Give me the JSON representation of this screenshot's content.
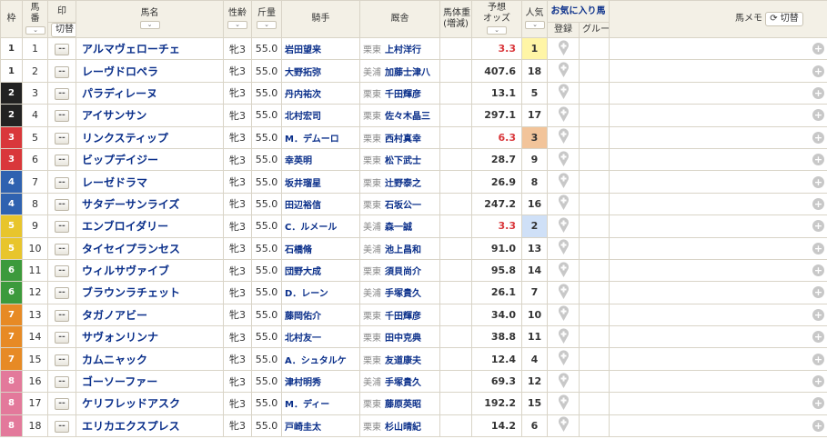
{
  "header": {
    "waku": "枠",
    "umaban_top": "馬",
    "umaban_bottom": "番",
    "mark_top": "印",
    "mark_switch": "切替",
    "horse_name": "馬名",
    "sex_age": "性齢",
    "weight": "斤量",
    "jockey": "騎手",
    "stable": "厩舎",
    "body_weight_top": "馬体重",
    "body_weight_bottom": "(増減)",
    "odds_top": "予想",
    "odds_bottom": "オッズ",
    "popularity": "人気",
    "favorites": "お気に入り馬",
    "fav_register": "登録",
    "fav_group": "グループ",
    "memo": "馬メモ",
    "memo_switch": "切替",
    "sort_icon": "⌄"
  },
  "colors": {
    "header_bg": "#f3f0e6",
    "link_blue": "#0a2f8a",
    "odds_hot": "#d9373b",
    "pop1": "#fff5a6",
    "pop2": "#cfe0f7",
    "pop3": "#f2c49a"
  },
  "rows": [
    {
      "waku": "1",
      "waku_class": "w1",
      "num": "1",
      "mark": "--",
      "name": "アルマヴェローチェ",
      "sexage": "牝3",
      "weight": "55.0",
      "jockey": "岩田望来",
      "place": "栗東",
      "trainer": "上村洋行",
      "odds": "3.3",
      "hot": true,
      "pop": "1",
      "pop_class": "pop1"
    },
    {
      "waku": "1",
      "waku_class": "w1",
      "num": "2",
      "mark": "--",
      "name": "レーヴドロペラ",
      "sexage": "牝3",
      "weight": "55.0",
      "jockey": "大野拓弥",
      "place": "美浦",
      "trainer": "加藤士津八",
      "odds": "407.6",
      "hot": false,
      "pop": "18",
      "pop_class": ""
    },
    {
      "waku": "2",
      "waku_class": "w2",
      "num": "3",
      "mark": "--",
      "name": "パラディレーヌ",
      "sexage": "牝3",
      "weight": "55.0",
      "jockey": "丹内祐次",
      "place": "栗東",
      "trainer": "千田輝彦",
      "odds": "13.1",
      "hot": false,
      "pop": "5",
      "pop_class": ""
    },
    {
      "waku": "2",
      "waku_class": "w2",
      "num": "4",
      "mark": "--",
      "name": "アイサンサン",
      "sexage": "牝3",
      "weight": "55.0",
      "jockey": "北村宏司",
      "place": "栗東",
      "trainer": "佐々木晶三",
      "odds": "297.1",
      "hot": false,
      "pop": "17",
      "pop_class": ""
    },
    {
      "waku": "3",
      "waku_class": "w3",
      "num": "5",
      "mark": "--",
      "name": "リンクスティップ",
      "sexage": "牝3",
      "weight": "55.0",
      "jockey": "M．デムーロ",
      "place": "栗東",
      "trainer": "西村真幸",
      "odds": "6.3",
      "hot": true,
      "pop": "3",
      "pop_class": "pop3"
    },
    {
      "waku": "3",
      "waku_class": "w3",
      "num": "6",
      "mark": "--",
      "name": "ビップデイジー",
      "sexage": "牝3",
      "weight": "55.0",
      "jockey": "幸英明",
      "place": "栗東",
      "trainer": "松下武士",
      "odds": "28.7",
      "hot": false,
      "pop": "9",
      "pop_class": ""
    },
    {
      "waku": "4",
      "waku_class": "w4",
      "num": "7",
      "mark": "--",
      "name": "レーゼドラマ",
      "sexage": "牝3",
      "weight": "55.0",
      "jockey": "坂井瑠星",
      "place": "栗東",
      "trainer": "辻野泰之",
      "odds": "26.9",
      "hot": false,
      "pop": "8",
      "pop_class": ""
    },
    {
      "waku": "4",
      "waku_class": "w4",
      "num": "8",
      "mark": "--",
      "name": "サタデーサンライズ",
      "sexage": "牝3",
      "weight": "55.0",
      "jockey": "田辺裕信",
      "place": "栗東",
      "trainer": "石坂公一",
      "odds": "247.2",
      "hot": false,
      "pop": "16",
      "pop_class": ""
    },
    {
      "waku": "5",
      "waku_class": "w5",
      "num": "9",
      "mark": "--",
      "name": "エンブロイダリー",
      "sexage": "牝3",
      "weight": "55.0",
      "jockey": "C．ルメール",
      "place": "美浦",
      "trainer": "森一誠",
      "odds": "3.3",
      "hot": true,
      "pop": "2",
      "pop_class": "pop2"
    },
    {
      "waku": "5",
      "waku_class": "w5",
      "num": "10",
      "mark": "--",
      "name": "タイセイプランセス",
      "sexage": "牝3",
      "weight": "55.0",
      "jockey": "石橋脩",
      "place": "美浦",
      "trainer": "池上昌和",
      "odds": "91.0",
      "hot": false,
      "pop": "13",
      "pop_class": ""
    },
    {
      "waku": "6",
      "waku_class": "w6",
      "num": "11",
      "mark": "--",
      "name": "ウィルサヴァイブ",
      "sexage": "牝3",
      "weight": "55.0",
      "jockey": "団野大成",
      "place": "栗東",
      "trainer": "須貝尚介",
      "odds": "95.8",
      "hot": false,
      "pop": "14",
      "pop_class": ""
    },
    {
      "waku": "6",
      "waku_class": "w6",
      "num": "12",
      "mark": "--",
      "name": "ブラウンラチェット",
      "sexage": "牝3",
      "weight": "55.0",
      "jockey": "D．レーン",
      "place": "美浦",
      "trainer": "手塚貴久",
      "odds": "26.1",
      "hot": false,
      "pop": "7",
      "pop_class": ""
    },
    {
      "waku": "7",
      "waku_class": "w7",
      "num": "13",
      "mark": "--",
      "name": "タガノアビー",
      "sexage": "牝3",
      "weight": "55.0",
      "jockey": "藤岡佑介",
      "place": "栗東",
      "trainer": "千田輝彦",
      "odds": "34.0",
      "hot": false,
      "pop": "10",
      "pop_class": ""
    },
    {
      "waku": "7",
      "waku_class": "w7",
      "num": "14",
      "mark": "--",
      "name": "サヴォンリンナ",
      "sexage": "牝3",
      "weight": "55.0",
      "jockey": "北村友一",
      "place": "栗東",
      "trainer": "田中克典",
      "odds": "38.8",
      "hot": false,
      "pop": "11",
      "pop_class": ""
    },
    {
      "waku": "7",
      "waku_class": "w7",
      "num": "15",
      "mark": "--",
      "name": "カムニャック",
      "sexage": "牝3",
      "weight": "55.0",
      "jockey": "A．シュタルケ",
      "place": "栗東",
      "trainer": "友道康夫",
      "odds": "12.4",
      "hot": false,
      "pop": "4",
      "pop_class": ""
    },
    {
      "waku": "8",
      "waku_class": "w8",
      "num": "16",
      "mark": "--",
      "name": "ゴーソーファー",
      "sexage": "牝3",
      "weight": "55.0",
      "jockey": "津村明秀",
      "place": "美浦",
      "trainer": "手塚貴久",
      "odds": "69.3",
      "hot": false,
      "pop": "12",
      "pop_class": ""
    },
    {
      "waku": "8",
      "waku_class": "w8",
      "num": "17",
      "mark": "--",
      "name": "ケリフレッドアスク",
      "sexage": "牝3",
      "weight": "55.0",
      "jockey": "M．ディー",
      "place": "栗東",
      "trainer": "藤原英昭",
      "odds": "192.2",
      "hot": false,
      "pop": "15",
      "pop_class": ""
    },
    {
      "waku": "8",
      "waku_class": "w8",
      "num": "18",
      "mark": "--",
      "name": "エリカエクスプレス",
      "sexage": "牝3",
      "weight": "55.0",
      "jockey": "戸崎圭太",
      "place": "栗東",
      "trainer": "杉山晴紀",
      "odds": "14.2",
      "hot": false,
      "pop": "6",
      "pop_class": ""
    }
  ]
}
